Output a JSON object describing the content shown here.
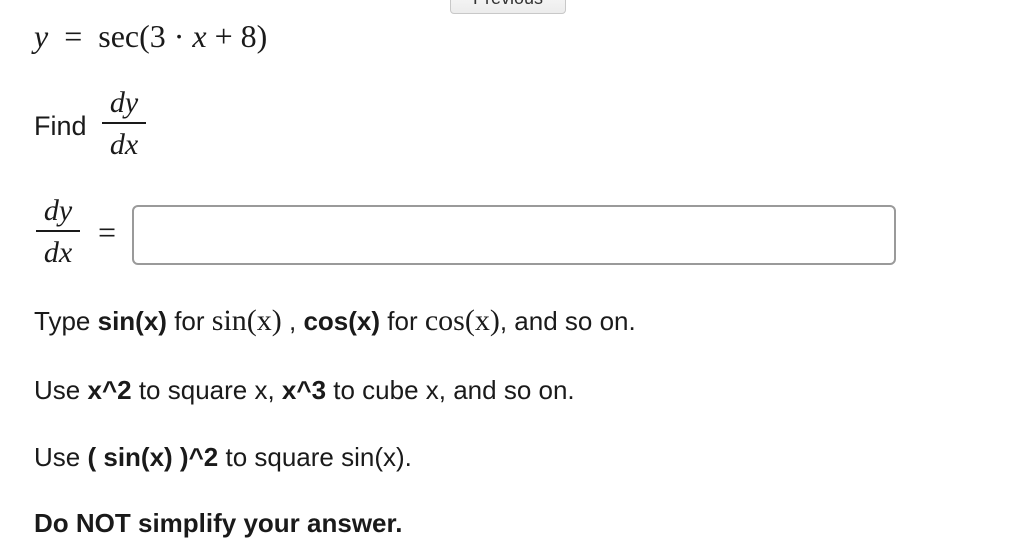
{
  "top_button": {
    "label": "Previous"
  },
  "equation": {
    "lhs": "y",
    "equals": "=",
    "func": "sec",
    "open": "(",
    "coef": "3",
    "dot": "·",
    "var": "x",
    "plus": "+",
    "const": "8",
    "close": ")"
  },
  "prompt": {
    "find_label": "Find",
    "numerator": "dy",
    "denominator": "dx"
  },
  "answer": {
    "numerator": "dy",
    "denominator": "dx",
    "equals": "=",
    "value": "",
    "placeholder": ""
  },
  "hints": {
    "h1_type": "Type",
    "h1_sin_code": "sin(x)",
    "h1_for": "for",
    "h1_sin_math": "sin(x)",
    "h1_comma": ",",
    "h1_cos_code": "cos(x)",
    "h1_for2": "for",
    "h1_cos_math": "cos(x)",
    "h1_end": ", and so on.",
    "h2_use": "Use",
    "h2_sq_code": "x^2",
    "h2_mid": "to square x,",
    "h2_cube_code": "x^3",
    "h2_end": "to cube x, and so on.",
    "h3_use": "Use",
    "h3_code": "( sin(x) )^2",
    "h3_end": "to square sin(x).",
    "h4": "Do NOT simplify your answer."
  }
}
